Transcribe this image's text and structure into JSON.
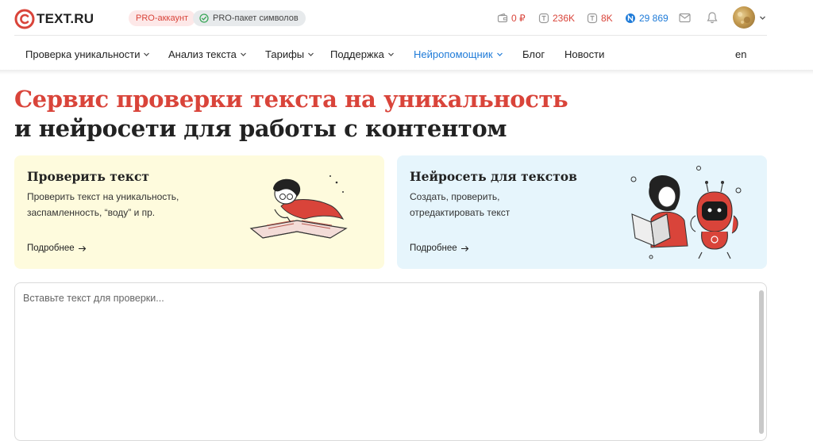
{
  "header": {
    "logo_text": "TEXT.RU",
    "badges": {
      "pro_account": "PRO-аккаунт",
      "pro_pack": "PRO-пакет символов"
    },
    "stats": [
      {
        "value": "0 ₽",
        "icon": "wallet-icon",
        "color": "#d9443a"
      },
      {
        "value": "236K",
        "icon": "text-credits-icon",
        "color": "#d9443a"
      },
      {
        "value": "8K",
        "icon": "text-credits-icon",
        "color": "#d9443a"
      },
      {
        "value": "29 869",
        "icon": "neuro-credits-icon",
        "color": "#1f7bd8"
      }
    ]
  },
  "nav": {
    "items": [
      {
        "label": "Проверка уникальности",
        "dropdown": true
      },
      {
        "label": "Анализ текста",
        "dropdown": true
      },
      {
        "label": "Тарифы",
        "dropdown": true
      },
      {
        "label": "Поддержка",
        "dropdown": true
      },
      {
        "label": "Нейропомощник",
        "dropdown": true,
        "active": true
      },
      {
        "label": "Блог",
        "dropdown": false
      },
      {
        "label": "Новости",
        "dropdown": false
      }
    ],
    "lang": "en"
  },
  "hero": {
    "title_line1": "Сервис проверки текста на уникальность",
    "title_line2": "и нейросети для работы с контентом"
  },
  "cards": {
    "check": {
      "title": "Проверить текст",
      "desc_line1": "Проверить текст на уникальность,",
      "desc_line2": "заспамленность, “воду” и пр.",
      "more": "Подробнее"
    },
    "neuro": {
      "title": "Нейросеть для текстов",
      "desc_line1": "Создать, проверить,",
      "desc_line2": "отредактировать текст",
      "more": "Подробнее"
    }
  },
  "editor": {
    "placeholder": "Вставьте текст для проверки..."
  },
  "colors": {
    "accent_red": "#d9443a",
    "accent_blue": "#1f7bd8",
    "card_yellow": "#fefbdd",
    "card_blue": "#e6f5fc"
  }
}
